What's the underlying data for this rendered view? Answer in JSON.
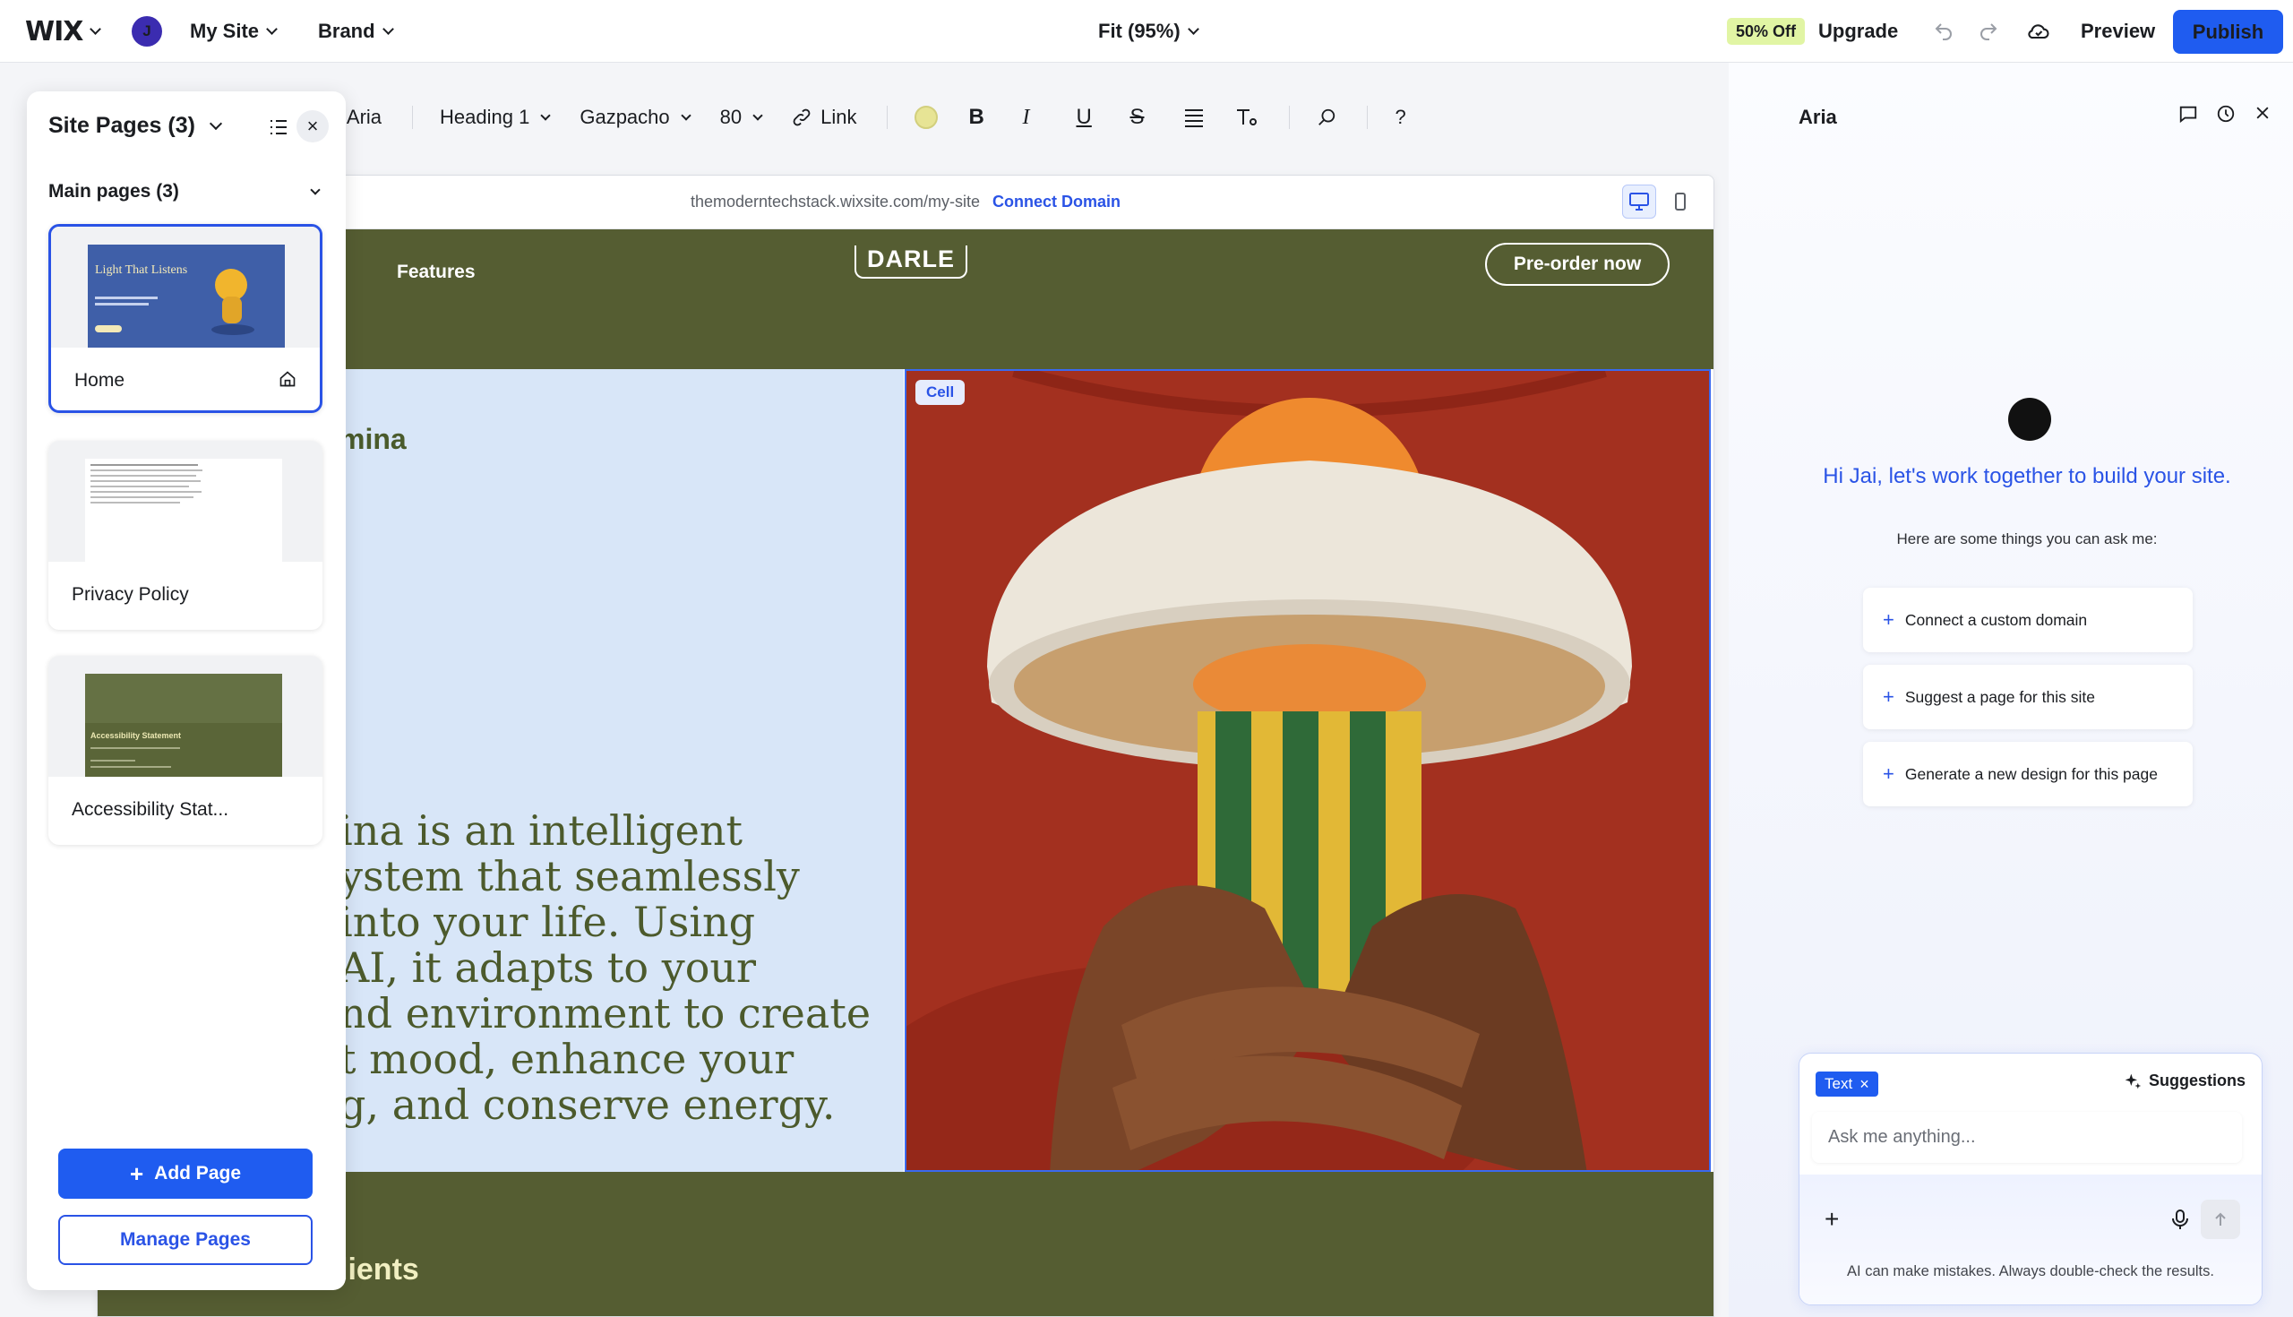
{
  "topbar": {
    "logo": "WIX",
    "avatar_initial": "J",
    "site_menu": "My Site",
    "brand_menu": "Brand",
    "zoom": "Fit (95%)",
    "discount_badge": "50% Off",
    "upgrade": "Upgrade",
    "preview": "Preview",
    "publish": "Publish"
  },
  "text_toolbar": {
    "ask_aria": "sk Aria",
    "style": "Heading 1",
    "font": "Gazpacho",
    "size": "80",
    "link": "Link",
    "color": "#e7e495",
    "bold": "B",
    "italic": "I",
    "underline": "U",
    "strike": "S",
    "help": "?"
  },
  "canvas": {
    "url": "themoderntechstack.wixsite.com/my-site",
    "connect_domain": "Connect Domain",
    "site": {
      "nav_features": "Features",
      "logo": "DARLE",
      "preorder": "Pre-order now",
      "brand_name_partial": "mina",
      "hero_lines": [
        "ina is an intelligent",
        "ystem that seamlessly",
        " into your life. Using",
        "AI, it adapts to your",
        "nd environment to create",
        "t mood, enhance your",
        "g, and conserve energy."
      ],
      "cell_badge": "Cell",
      "clients_heading": "lients"
    },
    "colors": {
      "header_bg": "#555d32",
      "hero_left_bg": "#d8e6f8",
      "selection": "#3a6af0"
    }
  },
  "pages_panel": {
    "title": "Site Pages (3)",
    "section": "Main pages (3)",
    "pages": [
      {
        "label": "Home",
        "thumb_title": "Light That Listens",
        "selected": true
      },
      {
        "label": "Privacy Policy",
        "selected": false
      },
      {
        "label": "Accessibility Stat...",
        "thumb_title": "Accessibility Statement",
        "selected": false
      }
    ],
    "add_page": "Add Page",
    "manage_pages": "Manage Pages"
  },
  "aria_panel": {
    "title": "Aria",
    "greeting": "Hi Jai, let's work together to build your site.",
    "subtitle": "Here are some things you can ask me:",
    "suggestions": [
      "Connect a custom domain",
      "Suggest a page for this site",
      "Generate a new design for this page"
    ],
    "chat_tag": "Text",
    "chat_suggestions": "Suggestions",
    "chat_placeholder": "Ask me anything...",
    "disclaimer": "AI can make mistakes. Always double-check the results."
  }
}
